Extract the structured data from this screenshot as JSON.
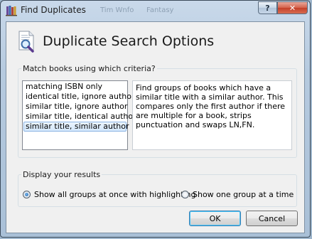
{
  "window": {
    "title": "Find Duplicates",
    "ghost_tabs": [
      "Tim Wnfo",
      "Fantasy"
    ],
    "help_label": "?",
    "close_label": "✕"
  },
  "header": {
    "title": "Duplicate Search Options"
  },
  "criteria": {
    "legend": "Match books using which criteria?",
    "options": [
      "matching ISBN only",
      "identical title, ignore author",
      "similar title, ignore author",
      "similar title, identical author",
      "similar title, similar author"
    ],
    "selected": "similar title, similar author",
    "description": "Find groups of books which have a similar title with a similar author. This compares only the first author if there are multiple for a book, strips punctuation and swaps LN,FN."
  },
  "results": {
    "legend": "Display your results",
    "option_all": "Show all groups at once with highlighting",
    "option_one": "Show one group at a time",
    "selected": "option_all"
  },
  "buttons": {
    "ok": "OK",
    "cancel": "Cancel"
  },
  "colors": {
    "selection_bg": "#d4e8fb",
    "selection_border": "#8db5e3",
    "close_button": "#c4402a"
  }
}
